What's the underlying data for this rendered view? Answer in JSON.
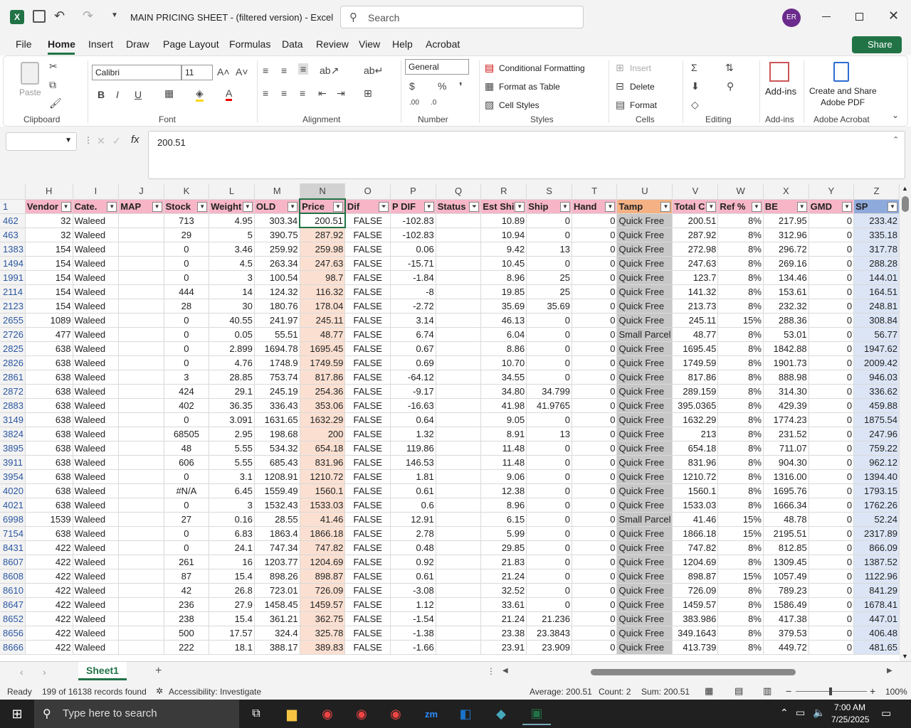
{
  "window": {
    "title": "MAIN PRICING SHEET - (filtered version)  -  Excel",
    "search_placeholder": "Search",
    "user_initials": "ER"
  },
  "menu": {
    "tabs": [
      "File",
      "Home",
      "Insert",
      "Draw",
      "Page Layout",
      "Formulas",
      "Data",
      "Review",
      "View",
      "Help",
      "Acrobat"
    ],
    "share": "Share"
  },
  "ribbon": {
    "clipboard": {
      "paste": "Paste",
      "label": "Clipboard"
    },
    "font": {
      "name": "Calibri",
      "size": "11",
      "label": "Font"
    },
    "alignment": {
      "label": "Alignment"
    },
    "number": {
      "format": "General",
      "label": "Number"
    },
    "styles": {
      "cond": "Conditional Formatting",
      "table": "Format as Table",
      "cell": "Cell Styles",
      "label": "Styles"
    },
    "cells": {
      "insert": "Insert",
      "delete": "Delete",
      "format": "Format",
      "label": "Cells"
    },
    "editing": {
      "label": "Editing"
    },
    "addins": {
      "btn": "Add-ins",
      "label": "Add-ins"
    },
    "acrobat": {
      "btn1": "Create and Share",
      "btn2": "Adobe PDF",
      "label": "Adobe Acrobat"
    }
  },
  "formula": {
    "name_box": "",
    "value": "200.51"
  },
  "columns": [
    "H",
    "I",
    "J",
    "K",
    "L",
    "M",
    "N",
    "O",
    "P",
    "Q",
    "R",
    "S",
    "T",
    "U",
    "V",
    "W",
    "X",
    "Y",
    "Z"
  ],
  "header_row": {
    "num": "1",
    "cells": [
      "Vendor",
      "Cate.",
      "MAP",
      "Stock",
      "Weight",
      "OLD",
      "Price",
      "Dif",
      "P DIF",
      "Status",
      "Est Ship",
      "Ship",
      "Hand",
      "Tamp",
      "Total C",
      "Ref %",
      "BE",
      "GMD",
      "SP"
    ]
  },
  "rows": [
    [
      "462",
      "32",
      "Waleed",
      "",
      "713",
      "4.95",
      "303.34",
      "200.51",
      "FALSE",
      "-102.83",
      "",
      "10.89",
      "0",
      "0",
      "Quick Free",
      "200.51",
      "8%",
      "217.95",
      "0",
      "233.42"
    ],
    [
      "463",
      "32",
      "Waleed",
      "",
      "29",
      "5",
      "390.75",
      "287.92",
      "FALSE",
      "-102.83",
      "",
      "10.94",
      "0",
      "0",
      "Quick Free",
      "287.92",
      "8%",
      "312.96",
      "0",
      "335.18"
    ],
    [
      "1383",
      "154",
      "Waleed",
      "",
      "0",
      "3.46",
      "259.92",
      "259.98",
      "FALSE",
      "0.06",
      "",
      "9.42",
      "13",
      "0",
      "Quick Free",
      "272.98",
      "8%",
      "296.72",
      "0",
      "317.78"
    ],
    [
      "1494",
      "154",
      "Waleed",
      "",
      "0",
      "4.5",
      "263.34",
      "247.63",
      "FALSE",
      "-15.71",
      "",
      "10.45",
      "0",
      "0",
      "Quick Free",
      "247.63",
      "8%",
      "269.16",
      "0",
      "288.28"
    ],
    [
      "1991",
      "154",
      "Waleed",
      "",
      "0",
      "3",
      "100.54",
      "98.7",
      "FALSE",
      "-1.84",
      "",
      "8.96",
      "25",
      "0",
      "Quick Free",
      "123.7",
      "8%",
      "134.46",
      "0",
      "144.01"
    ],
    [
      "2114",
      "154",
      "Waleed",
      "",
      "444",
      "14",
      "124.32",
      "116.32",
      "FALSE",
      "-8",
      "",
      "19.85",
      "25",
      "0",
      "Quick Free",
      "141.32",
      "8%",
      "153.61",
      "0",
      "164.51"
    ],
    [
      "2123",
      "154",
      "Waleed",
      "",
      "28",
      "30",
      "180.76",
      "178.04",
      "FALSE",
      "-2.72",
      "",
      "35.69",
      "35.69",
      "0",
      "Quick Free",
      "213.73",
      "8%",
      "232.32",
      "0",
      "248.81"
    ],
    [
      "2655",
      "1089",
      "Waleed",
      "",
      "0",
      "40.55",
      "241.97",
      "245.11",
      "FALSE",
      "3.14",
      "",
      "46.13",
      "0",
      "0",
      "Quick Free",
      "245.11",
      "15%",
      "288.36",
      "0",
      "308.84"
    ],
    [
      "2726",
      "477",
      "Waleed",
      "",
      "0",
      "0.05",
      "55.51",
      "48.77",
      "FALSE",
      "6.74",
      "",
      "6.04",
      "0",
      "0",
      "Small Parcel",
      "48.77",
      "8%",
      "53.01",
      "0",
      "56.77"
    ],
    [
      "2825",
      "638",
      "Waleed",
      "",
      "0",
      "2.899",
      "1694.78",
      "1695.45",
      "FALSE",
      "0.67",
      "",
      "8.86",
      "0",
      "0",
      "Quick Free",
      "1695.45",
      "8%",
      "1842.88",
      "0",
      "1947.62"
    ],
    [
      "2826",
      "638",
      "Waleed",
      "",
      "0",
      "4.76",
      "1748.9",
      "1749.59",
      "FALSE",
      "0.69",
      "",
      "10.70",
      "0",
      "0",
      "Quick Free",
      "1749.59",
      "8%",
      "1901.73",
      "0",
      "2009.42"
    ],
    [
      "2861",
      "638",
      "Waleed",
      "",
      "3",
      "28.85",
      "753.74",
      "817.86",
      "FALSE",
      "-64.12",
      "",
      "34.55",
      "0",
      "0",
      "Quick Free",
      "817.86",
      "8%",
      "888.98",
      "0",
      "946.03"
    ],
    [
      "2872",
      "638",
      "Waleed",
      "",
      "424",
      "29.1",
      "245.19",
      "254.36",
      "FALSE",
      "-9.17",
      "",
      "34.80",
      "34.799",
      "0",
      "Quick Free",
      "289.159",
      "8%",
      "314.30",
      "0",
      "336.62"
    ],
    [
      "2883",
      "638",
      "Waleed",
      "",
      "402",
      "36.35",
      "336.43",
      "353.06",
      "FALSE",
      "-16.63",
      "",
      "41.98",
      "41.9765",
      "0",
      "Quick Free",
      "395.0365",
      "8%",
      "429.39",
      "0",
      "459.88"
    ],
    [
      "3149",
      "638",
      "Waleed",
      "",
      "0",
      "3.091",
      "1631.65",
      "1632.29",
      "FALSE",
      "0.64",
      "",
      "9.05",
      "0",
      "0",
      "Quick Free",
      "1632.29",
      "8%",
      "1774.23",
      "0",
      "1875.54"
    ],
    [
      "3824",
      "638",
      "Waleed",
      "",
      "68505",
      "2.95",
      "198.68",
      "200",
      "FALSE",
      "1.32",
      "",
      "8.91",
      "13",
      "0",
      "Quick Free",
      "213",
      "8%",
      "231.52",
      "0",
      "247.96"
    ],
    [
      "3895",
      "638",
      "Waleed",
      "",
      "48",
      "5.55",
      "534.32",
      "654.18",
      "FALSE",
      "119.86",
      "",
      "11.48",
      "0",
      "0",
      "Quick Free",
      "654.18",
      "8%",
      "711.07",
      "0",
      "759.22"
    ],
    [
      "3911",
      "638",
      "Waleed",
      "",
      "606",
      "5.55",
      "685.43",
      "831.96",
      "FALSE",
      "146.53",
      "",
      "11.48",
      "0",
      "0",
      "Quick Free",
      "831.96",
      "8%",
      "904.30",
      "0",
      "962.12"
    ],
    [
      "3954",
      "638",
      "Waleed",
      "",
      "0",
      "3.1",
      "1208.91",
      "1210.72",
      "FALSE",
      "1.81",
      "",
      "9.06",
      "0",
      "0",
      "Quick Free",
      "1210.72",
      "8%",
      "1316.00",
      "0",
      "1394.40"
    ],
    [
      "4020",
      "638",
      "Waleed",
      "",
      "#N/A",
      "6.45",
      "1559.49",
      "1560.1",
      "FALSE",
      "0.61",
      "",
      "12.38",
      "0",
      "0",
      "Quick Free",
      "1560.1",
      "8%",
      "1695.76",
      "0",
      "1793.15"
    ],
    [
      "4021",
      "638",
      "Waleed",
      "",
      "0",
      "3",
      "1532.43",
      "1533.03",
      "FALSE",
      "0.6",
      "",
      "8.96",
      "0",
      "0",
      "Quick Free",
      "1533.03",
      "8%",
      "1666.34",
      "0",
      "1762.26"
    ],
    [
      "6998",
      "1539",
      "Waleed",
      "",
      "27",
      "0.16",
      "28.55",
      "41.46",
      "FALSE",
      "12.91",
      "",
      "6.15",
      "0",
      "0",
      "Small Parcel",
      "41.46",
      "15%",
      "48.78",
      "0",
      "52.24"
    ],
    [
      "7154",
      "638",
      "Waleed",
      "",
      "0",
      "6.83",
      "1863.4",
      "1866.18",
      "FALSE",
      "2.78",
      "",
      "5.99",
      "0",
      "0",
      "Quick Free",
      "1866.18",
      "15%",
      "2195.51",
      "0",
      "2317.89"
    ],
    [
      "8431",
      "422",
      "Waleed",
      "",
      "0",
      "24.1",
      "747.34",
      "747.82",
      "FALSE",
      "0.48",
      "",
      "29.85",
      "0",
      "0",
      "Quick Free",
      "747.82",
      "8%",
      "812.85",
      "0",
      "866.09"
    ],
    [
      "8607",
      "422",
      "Waleed",
      "",
      "261",
      "16",
      "1203.77",
      "1204.69",
      "FALSE",
      "0.92",
      "",
      "21.83",
      "0",
      "0",
      "Quick Free",
      "1204.69",
      "8%",
      "1309.45",
      "0",
      "1387.52"
    ],
    [
      "8608",
      "422",
      "Waleed",
      "",
      "87",
      "15.4",
      "898.26",
      "898.87",
      "FALSE",
      "0.61",
      "",
      "21.24",
      "0",
      "0",
      "Quick Free",
      "898.87",
      "15%",
      "1057.49",
      "0",
      "1122.96"
    ],
    [
      "8610",
      "422",
      "Waleed",
      "",
      "42",
      "26.8",
      "723.01",
      "726.09",
      "FALSE",
      "-3.08",
      "",
      "32.52",
      "0",
      "0",
      "Quick Free",
      "726.09",
      "8%",
      "789.23",
      "0",
      "841.29"
    ],
    [
      "8647",
      "422",
      "Waleed",
      "",
      "236",
      "27.9",
      "1458.45",
      "1459.57",
      "FALSE",
      "1.12",
      "",
      "33.61",
      "0",
      "0",
      "Quick Free",
      "1459.57",
      "8%",
      "1586.49",
      "0",
      "1678.41"
    ],
    [
      "8652",
      "422",
      "Waleed",
      "",
      "238",
      "15.4",
      "361.21",
      "362.75",
      "FALSE",
      "-1.54",
      "",
      "21.24",
      "21.236",
      "0",
      "Quick Free",
      "383.986",
      "8%",
      "417.38",
      "0",
      "447.01"
    ],
    [
      "8656",
      "422",
      "Waleed",
      "",
      "500",
      "17.57",
      "324.4",
      "325.78",
      "FALSE",
      "-1.38",
      "",
      "23.38",
      "23.3843",
      "0",
      "Quick Free",
      "349.1643",
      "8%",
      "379.53",
      "0",
      "406.48"
    ],
    [
      "8666",
      "422",
      "Waleed",
      "",
      "222",
      "18.1",
      "388.17",
      "389.83",
      "FALSE",
      "-1.66",
      "",
      "23.91",
      "23.909",
      "0",
      "Quick Free",
      "413.739",
      "8%",
      "449.72",
      "0",
      "481.65"
    ]
  ],
  "sheet": {
    "tab": "Sheet1"
  },
  "status": {
    "ready": "Ready",
    "records": "199 of 16138 records found",
    "accessibility": "Accessibility: Investigate",
    "average": "Average: 200.51",
    "count": "Count: 2",
    "sum": "Sum: 200.51",
    "zoom": "100%"
  },
  "taskbar": {
    "search": "Type here to search",
    "time": "7:00 AM",
    "date": "7/25/2025"
  },
  "colors": {
    "accent": "#217346",
    "header_pink": "#f7b6c8",
    "price_col": "#fbe0d2",
    "tamp_col": "#c8c8c8",
    "sp_col": "#dbe5f5",
    "tamp_header": "#f4b183",
    "sp_header": "#8ea9db"
  }
}
